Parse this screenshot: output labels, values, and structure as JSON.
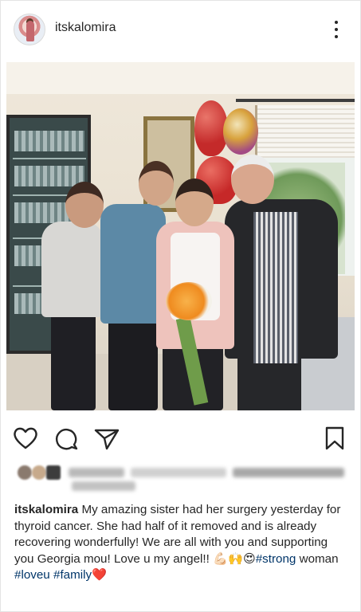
{
  "header": {
    "username": "itskalomira",
    "more_icon": "more-vertical-icon"
  },
  "photo": {
    "description_icon": "post-photo"
  },
  "actions": {
    "like_icon": "heart-icon",
    "comment_icon": "comment-icon",
    "share_icon": "send-icon",
    "save_icon": "bookmark-icon"
  },
  "caption": {
    "username": "itskalomira",
    "text": "My amazing sister had her surgery yesterday for thyroid cancer. She had half of it removed and is already recovering wonderfully! We are all with you and supporting you Georgia mou! Love u my angel!! ",
    "emoji": "💪🏻🙌😍",
    "tags": [
      "#strong",
      "woman",
      "#loveu",
      "#family"
    ],
    "end_emoji": "❤️"
  },
  "colors": {
    "text": "#262626",
    "hashtag": "#003569",
    "divider": "#efefef"
  }
}
